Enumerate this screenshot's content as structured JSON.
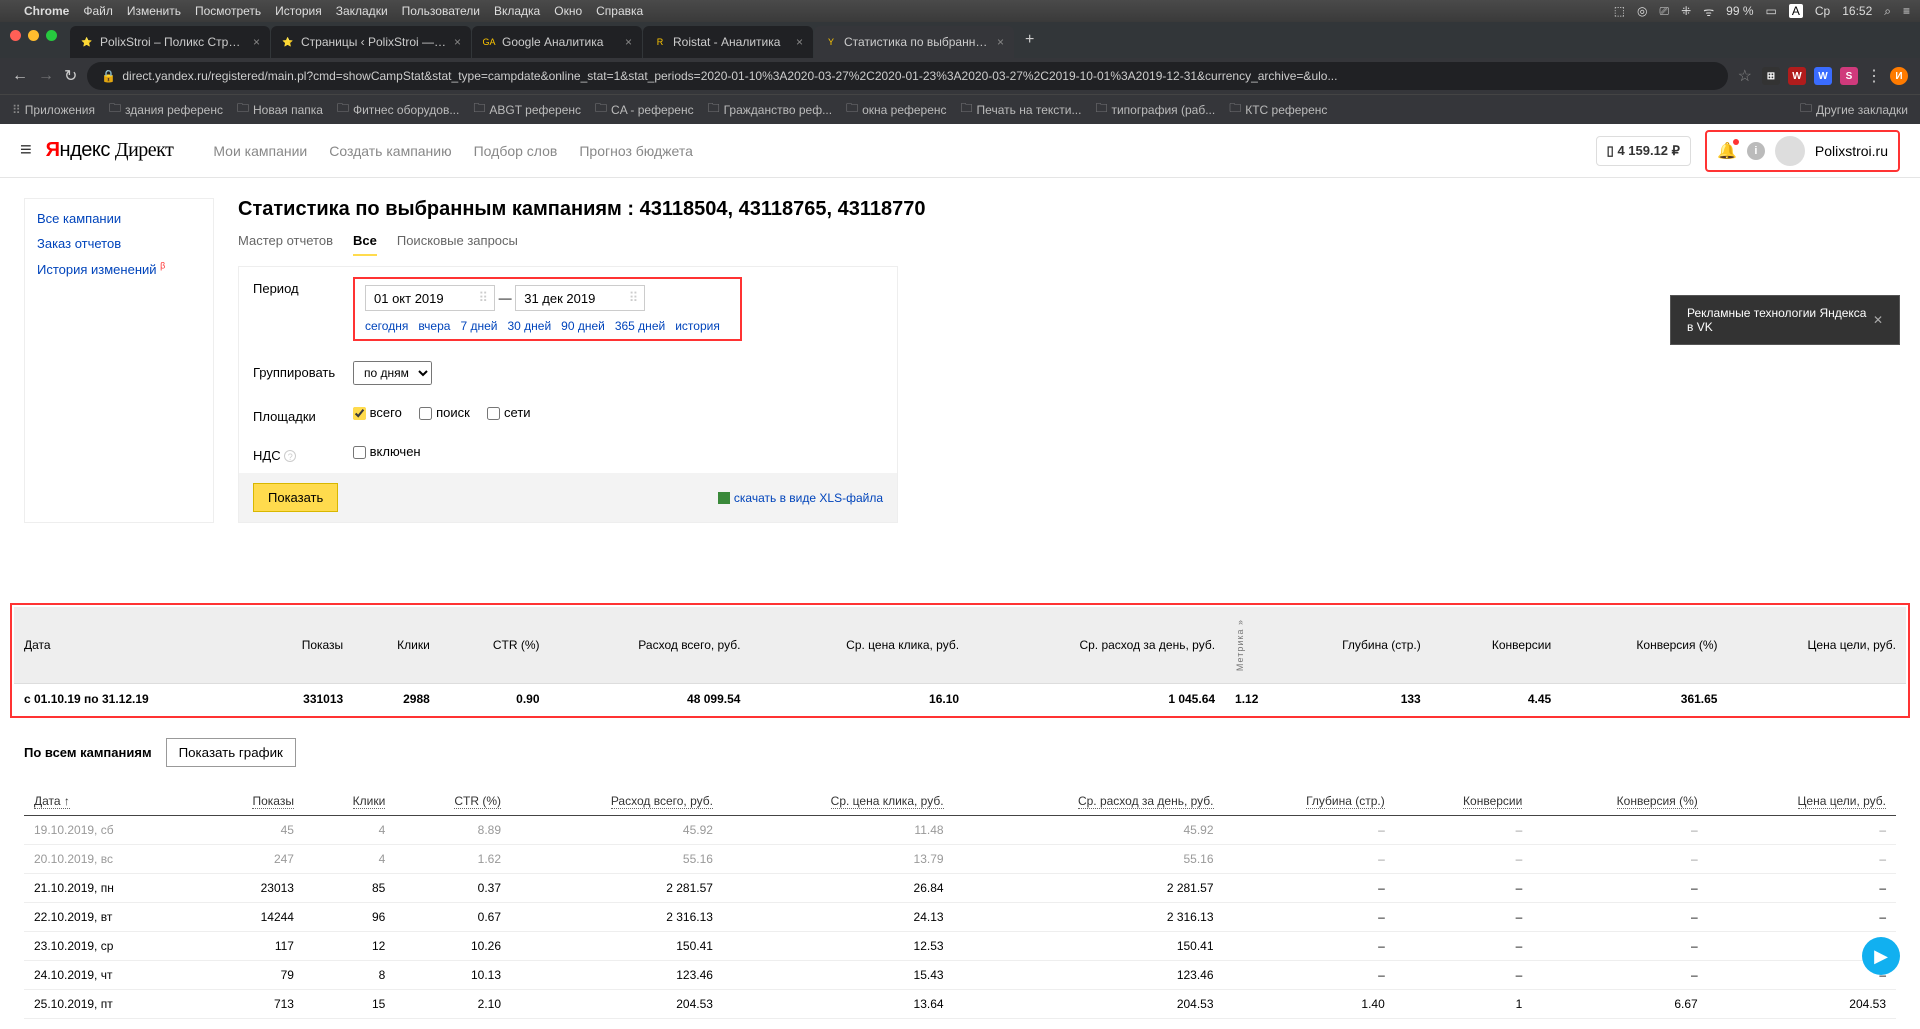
{
  "mac_menu": {
    "app": "Chrome",
    "items": [
      "Файл",
      "Изменить",
      "Посмотреть",
      "История",
      "Закладки",
      "Пользователи",
      "Вкладка",
      "Окно",
      "Справка"
    ],
    "status": {
      "battery": "99 %",
      "battery_icon": "🔋",
      "lang": "A",
      "day": "Ср",
      "time": "16:52"
    }
  },
  "tabs": [
    {
      "favicon": "⭐",
      "title": "PolixStroi – Поликс Строй – ст",
      "active": false
    },
    {
      "favicon": "⭐",
      "title": "Страницы ‹ PolixStroi — Word",
      "active": false
    },
    {
      "favicon": "GA",
      "title": "Google Аналитика",
      "active": false
    },
    {
      "favicon": "R",
      "title": "Roistat - Аналитика",
      "active": false
    },
    {
      "favicon": "Y",
      "title": "Статистика по выбранным к",
      "active": true
    }
  ],
  "url": "direct.yandex.ru/registered/main.pl?cmd=showCampStat&stat_type=campdate&online_stat=1&stat_periods=2020-01-10%3A2020-03-27%2C2020-01-23%3A2020-03-27%2C2019-10-01%3A2019-12-31&currency_archive=&ulo...",
  "bookmarks": {
    "apps": "Приложения",
    "items": [
      "здания референс",
      "Новая папка",
      "Фитнес оборудов...",
      "ABGT референс",
      "CA - референс",
      "Гражданство реф...",
      "окна референс",
      "Печать на тексти...",
      "типография (раб...",
      "КТС референс"
    ],
    "other": "Другие закладки"
  },
  "app_header": {
    "logo_ya": "Я",
    "logo_ndex": "ндекс ",
    "logo_direct": "Директ",
    "nav": [
      "Мои кампании",
      "Создать кампанию",
      "Подбор слов",
      "Прогноз бюджета"
    ],
    "balance": "4 159.12 ₽",
    "username": "Polixstroi.ru"
  },
  "sidebar": {
    "all": "Все кампании",
    "order": "Заказ отчетов",
    "history": "История изменений",
    "beta": "β"
  },
  "main": {
    "title": "Статистика по выбранным кампаниям : 43118504, 43118765, 43118770",
    "inner_tabs": [
      "Мастер отчетов",
      "Все",
      "Поисковые запросы"
    ],
    "period_label": "Период",
    "date_from": "01 окт 2019",
    "date_to": "31 дек 2019",
    "date_links": [
      "сегодня",
      "вчера",
      "7 дней",
      "30 дней",
      "90 дней",
      "365 дней",
      "история"
    ],
    "group_label": "Группировать",
    "group_value": "по дням",
    "platforms_label": "Площадки",
    "platforms": {
      "all": "всего",
      "search": "поиск",
      "net": "сети"
    },
    "vat_label": "НДС",
    "vat_opt": "включен",
    "show_btn": "Показать",
    "download": "скачать в виде XLS-файла"
  },
  "columns": {
    "date": "Дата",
    "shows": "Показы",
    "clicks": "Клики",
    "ctr": "CTR (%)",
    "spend": "Расход всего, руб.",
    "cpc": "Ср. цена клика, руб.",
    "daily": "Ср. расход за день, руб.",
    "depth": "Глубина (стр.)",
    "conv": "Конверсии",
    "conv_pct": "Конверсия (%)",
    "goal": "Цена цели, руб.",
    "metrika": "Метрика »"
  },
  "summary": {
    "date": "с 01.10.19 по 31.12.19",
    "shows": "331013",
    "clicks": "2988",
    "ctr": "0.90",
    "spend": "48 099.54",
    "cpc": "16.10",
    "daily": "1 045.64",
    "depth": "1.12",
    "conv": "133",
    "conv_pct": "4.45",
    "goal": "361.65"
  },
  "under": {
    "heading": "По всем кампаниям",
    "chart_btn": "Показать график",
    "date_sort": "Дата ↑"
  },
  "rows": [
    {
      "date": "19.10.2019, сб",
      "shows": "45",
      "clicks": "4",
      "ctr": "8.89",
      "spend": "45.92",
      "cpc": "11.48",
      "daily": "45.92",
      "depth": "–",
      "conv": "–",
      "conv_pct": "–",
      "goal": "–",
      "faded": true
    },
    {
      "date": "20.10.2019, вс",
      "shows": "247",
      "clicks": "4",
      "ctr": "1.62",
      "spend": "55.16",
      "cpc": "13.79",
      "daily": "55.16",
      "depth": "–",
      "conv": "–",
      "conv_pct": "–",
      "goal": "–",
      "faded": true
    },
    {
      "date": "21.10.2019, пн",
      "shows": "23013",
      "clicks": "85",
      "ctr": "0.37",
      "spend": "2 281.57",
      "cpc": "26.84",
      "daily": "2 281.57",
      "depth": "–",
      "conv": "–",
      "conv_pct": "–",
      "goal": "–"
    },
    {
      "date": "22.10.2019, вт",
      "shows": "14244",
      "clicks": "96",
      "ctr": "0.67",
      "spend": "2 316.13",
      "cpc": "24.13",
      "daily": "2 316.13",
      "depth": "–",
      "conv": "–",
      "conv_pct": "–",
      "goal": "–"
    },
    {
      "date": "23.10.2019, ср",
      "shows": "117",
      "clicks": "12",
      "ctr": "10.26",
      "spend": "150.41",
      "cpc": "12.53",
      "daily": "150.41",
      "depth": "–",
      "conv": "–",
      "conv_pct": "–",
      "goal": "–"
    },
    {
      "date": "24.10.2019, чт",
      "shows": "79",
      "clicks": "8",
      "ctr": "10.13",
      "spend": "123.46",
      "cpc": "15.43",
      "daily": "123.46",
      "depth": "–",
      "conv": "–",
      "conv_pct": "–",
      "goal": "–"
    },
    {
      "date": "25.10.2019, пт",
      "shows": "713",
      "clicks": "15",
      "ctr": "2.10",
      "spend": "204.53",
      "cpc": "13.64",
      "daily": "204.53",
      "depth": "1.40",
      "conv": "1",
      "conv_pct": "6.67",
      "goal": "204.53"
    }
  ],
  "toast": {
    "text": "Рекламные технологии Яндекса в VK"
  }
}
